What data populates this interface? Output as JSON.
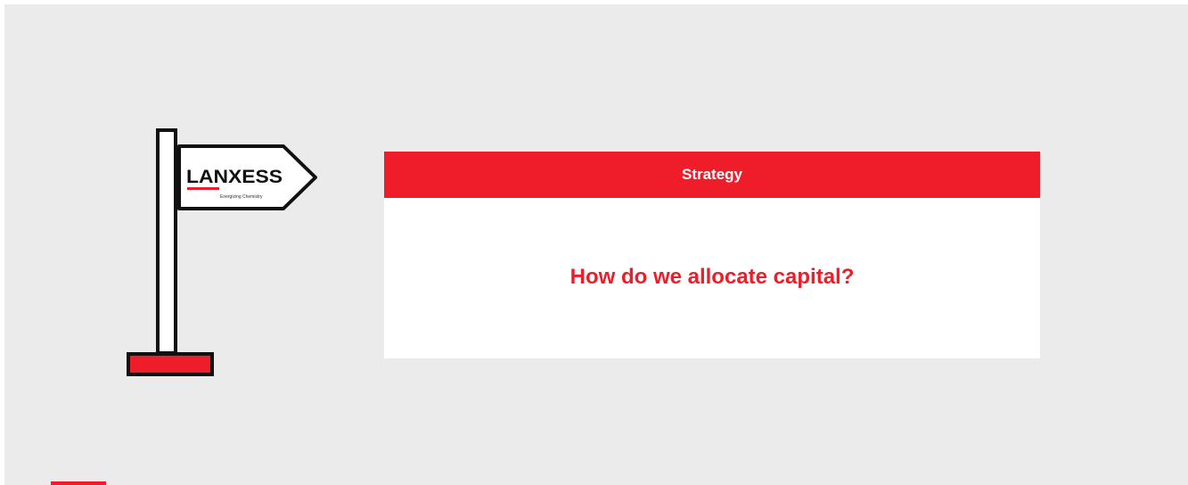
{
  "section": {
    "header": "Strategy",
    "question": "How do we allocate capital?"
  },
  "signpost": {
    "icon": "signpost-icon",
    "logo_text": "LANXESS",
    "logo_tagline": "Energizing Chemistry"
  },
  "colors": {
    "accent": "#ef1c2a",
    "background": "#ebebeb",
    "card": "#ffffff",
    "outline": "#111111"
  }
}
